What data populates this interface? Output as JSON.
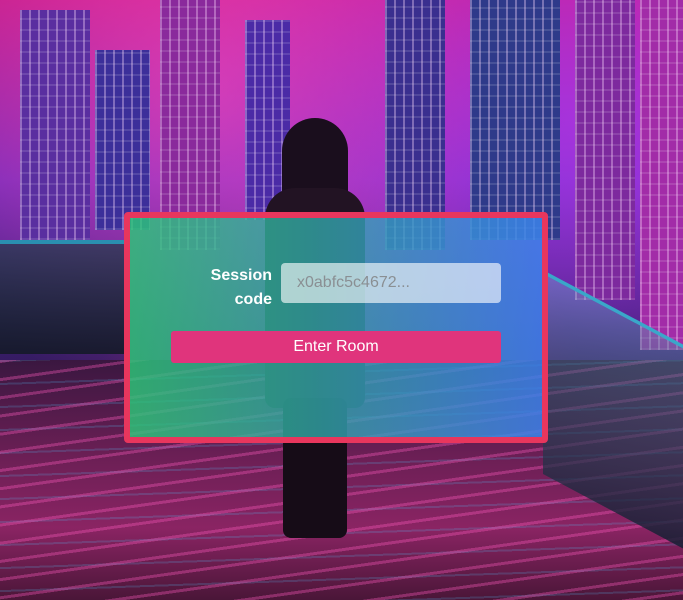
{
  "form": {
    "session_label": "Session code",
    "session_placeholder": "x0abfc5c4672...",
    "enter_button_label": "Enter Room"
  },
  "colors": {
    "panel_border": "#e8365d",
    "panel_gradient_start": "#2cc878",
    "panel_gradient_end": "#3c82eb",
    "button": "#e0347c"
  }
}
